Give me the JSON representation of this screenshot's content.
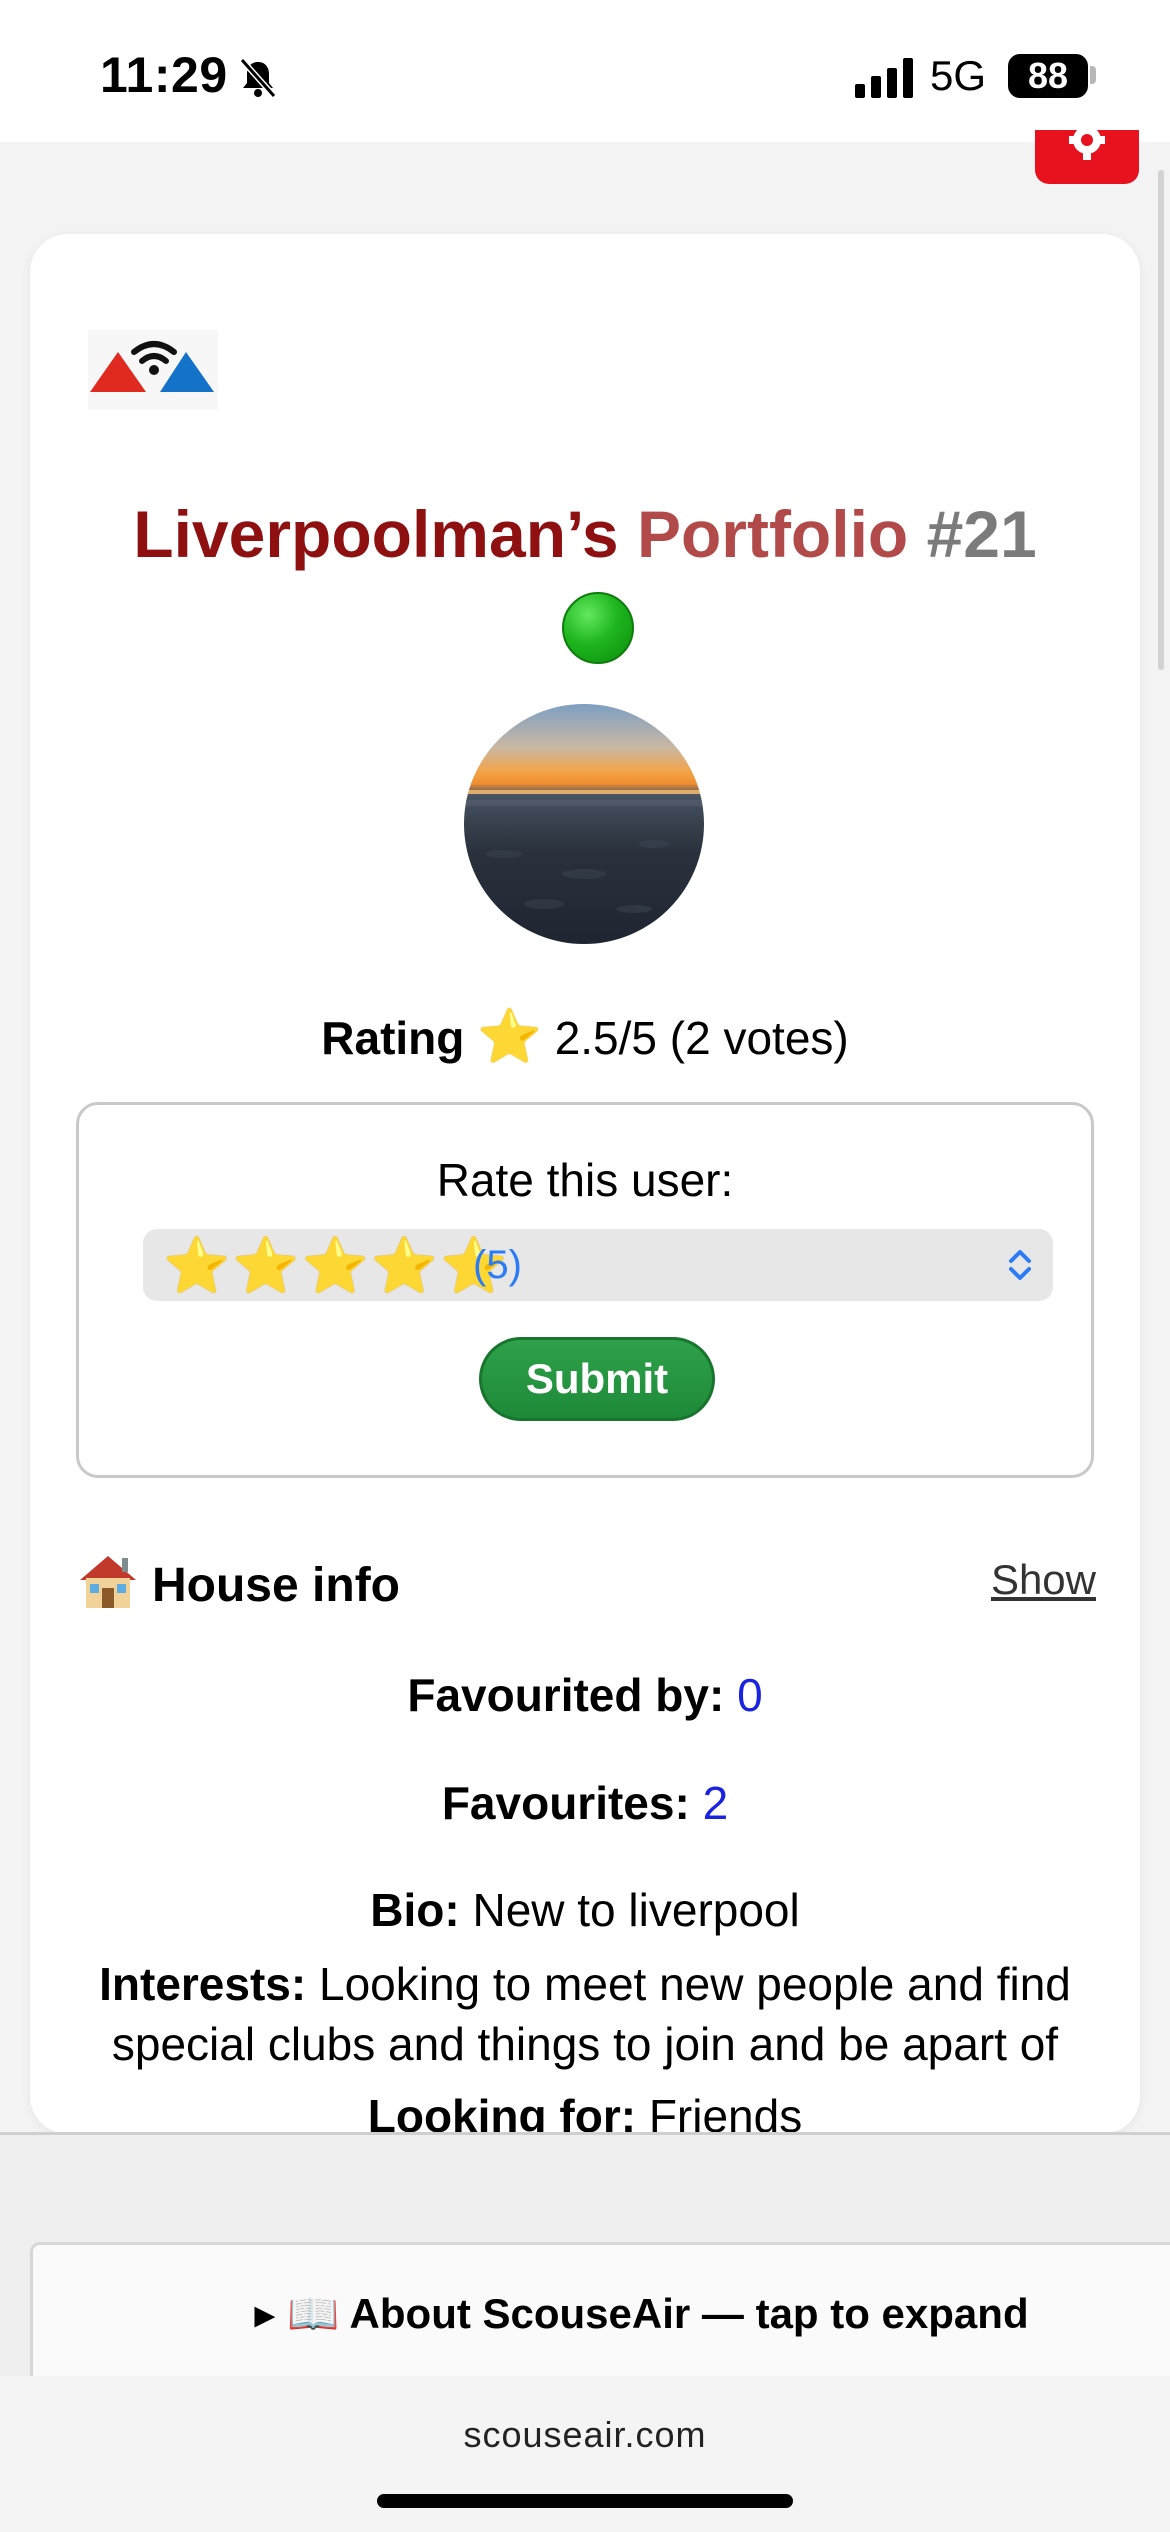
{
  "status_bar": {
    "time": "11:29",
    "network": "5G",
    "battery": "88"
  },
  "profile": {
    "title_name": "Liverpoolman’s",
    "title_portfolio": "Portfolio",
    "title_number": "#21",
    "online_status_icon": "online-dot",
    "rating_label": "Rating",
    "rating_value": "2.5/5 (2 votes)"
  },
  "rate": {
    "label": "Rate this user:",
    "selected_stars": "⭐⭐⭐⭐⭐",
    "selected_count": "(5)",
    "submit_label": "Submit"
  },
  "house_info": {
    "title": "House info",
    "toggle_label": "Show",
    "favourited_by_label": "Favourited by:",
    "favourited_by_value": "0",
    "favourites_label": "Favourites:",
    "favourites_value": "2",
    "bio_label": "Bio:",
    "bio_value": "New to liverpool",
    "interests_label": "Interests:",
    "interests_value": "Looking to meet new people and find special clubs and things to join and be apart of",
    "looking_for_label": "Looking for:",
    "looking_for_value": "Friends"
  },
  "about": {
    "label": "▸ 📖 About ScouseAir — tap to expand"
  },
  "browser": {
    "url": "scouseair.com"
  },
  "colors": {
    "title_dark_red": "#8e1010",
    "title_light_red": "#b34a4a",
    "title_grey": "#7b7b7b",
    "submit_green": "#1e8a38",
    "link_blue": "#1a24e0",
    "accent_red": "#e8121e"
  }
}
